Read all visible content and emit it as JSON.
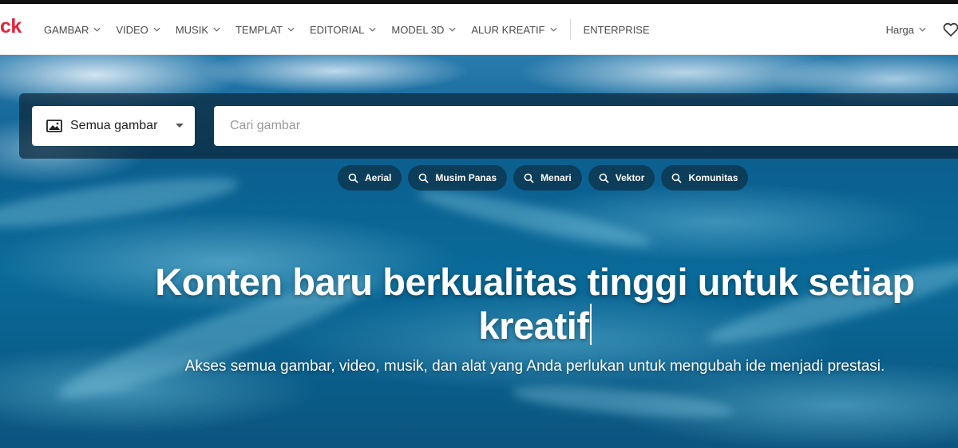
{
  "brand": {
    "logo_text": "ck",
    "color": "#e8203a"
  },
  "nav": {
    "items": [
      {
        "label": "GAMBAR",
        "has_dropdown": true
      },
      {
        "label": "VIDEO",
        "has_dropdown": true
      },
      {
        "label": "MUSIK",
        "has_dropdown": true
      },
      {
        "label": "TEMPLAT",
        "has_dropdown": true
      },
      {
        "label": "EDITORIAL",
        "has_dropdown": true
      },
      {
        "label": "MODEL 3D",
        "has_dropdown": true
      },
      {
        "label": "ALUR KREATIF",
        "has_dropdown": true
      }
    ],
    "enterprise_label": "ENTERPRISE",
    "pricing_label": "Harga",
    "icons": [
      "chevron-down-icon",
      "heart-icon"
    ]
  },
  "search": {
    "type_select_value": "Semua gambar",
    "type_icon": "image-icon",
    "placeholder": "Cari gambar",
    "value": ""
  },
  "suggestions": [
    {
      "label": "Aerial"
    },
    {
      "label": "Musim Panas"
    },
    {
      "label": "Menari"
    },
    {
      "label": "Vektor"
    },
    {
      "label": "Komunitas"
    }
  ],
  "hero": {
    "headline": "Konten baru berkualitas tinggi untuk setiap kreatif",
    "subheadline": "Akses semua gambar, video, musik, dan alat yang Anda perlukan untuk mengubah ide menjadi prestasi."
  }
}
